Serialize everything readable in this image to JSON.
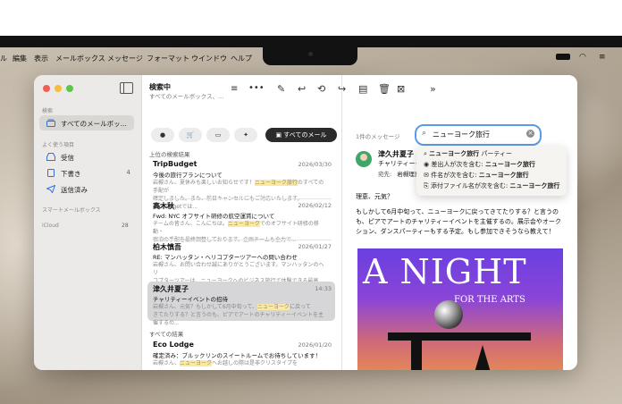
{
  "menubar": {
    "items": [
      "ル",
      "編集",
      "表示",
      "メールボックス",
      "メッセージ",
      "フォーマット",
      "ウインドウ",
      "ヘルプ"
    ]
  },
  "toolbar": {
    "title": "検索中",
    "subtitle": "すべてのメールボックス、..."
  },
  "sidebar": {
    "favorites_label": "検索",
    "all_mail": "すべてのメールボッ...",
    "frequent_label": "よく使う項目",
    "items": [
      {
        "label": "受信",
        "count": ""
      },
      {
        "label": "下書き",
        "count": "4"
      },
      {
        "label": "送信済み",
        "count": ""
      }
    ],
    "smart_label": "スマートメールボックス",
    "icloud_label": "iCloud",
    "icloud_count": "28"
  },
  "filters": {
    "all_mail_chip": "すべてのメール"
  },
  "list": {
    "top_hits_label": "上位の検索結果",
    "all_results_label": "すべての結果",
    "messages": [
      {
        "from": "TripBudget",
        "date": "2026/03/30",
        "subject": "今後の旅行プランについて",
        "preview_a": "岩槻さん、夏休みも楽しいお知らせです！",
        "preview_hl": "ニューヨーク旅行",
        "preview_b": "のすべての手配が",
        "preview_c": "確定しました。また、前日キャンセルにもご対応いたします。TripBudgetでは..."
      },
      {
        "from": "高木秋",
        "date": "2026/02/12",
        "subject": "Fwd: NYC オフサイト研修の航空運賃について",
        "preview_a": "チームの皆さん、こんにちは。",
        "preview_hl": "ニューヨーク",
        "preview_b": "でのオフサイト研修の移動・",
        "preview_c": "宿泊の手配を最終調整しております。企画チームも全力で..."
      },
      {
        "from": "柏木慎吾",
        "date": "2026/01/27",
        "subject": "RE: マンハッタン・ヘリコプターツアーへの問い合わせ",
        "preview_a": "岩槻さん、お問い合わせ誠にありがとうございます。マンハッタンのヘリ",
        "preview_hl": "ニューヨーク",
        "preview_b": "",
        "preview_c": "コプターツアーは、ニューヨークへのビジネス旅行で体験できる最高の..."
      },
      {
        "from": "津久井夏子",
        "date": "14:33",
        "subject": "チャリティーイベントの招待",
        "preview_a": "岩槻さん、元気？もしかして6月中旬って、",
        "preview_hl": "ニューヨーク",
        "preview_b": "に戻って",
        "preview_c": "きてたりする？と言うのも、ピアでアートのチャリティーイベントを主催するの..."
      },
      {
        "from": "Eco Lodge",
        "date": "2026/01/20",
        "subject": "確定済み：ブルックリンのスイートルームでお待ちしています！",
        "preview_a": "岩槻さん、",
        "preview_hl": "ニューヨーク",
        "preview_b": "へお越しの際は是非クリスタイプを",
        "preview_c": "ご利用..."
      }
    ]
  },
  "search": {
    "query": "ニューヨーク旅行",
    "suggestions": [
      {
        "prefix": "",
        "bold": "ニューヨーク旅行",
        "suffix": " パーティー"
      },
      {
        "prefix": "差出人が次を含む: ",
        "bold": "ニューヨーク旅行",
        "suffix": ""
      },
      {
        "prefix": "件名が次を含む: ",
        "bold": "ニューヨーク旅行",
        "suffix": ""
      },
      {
        "prefix": "添付ファイル名が次を含む: ",
        "bold": "ニューヨーク旅行",
        "suffix": ""
      }
    ]
  },
  "reader": {
    "count_label": "1件のメッセージ",
    "sender": "津久井夏子",
    "subject": "チャリティーイベントの招待",
    "to_label": "宛先:",
    "to_name": "岩槻理恵",
    "greeting": "理恵、元気？",
    "body": "もしかして6月中旬って、ニューヨークに戻ってきてたりする？と言うのも、ピアでアートのチャリティーイベントを主催するの。展示会やオークション、ダンスパーティーもする予定。もし参加できそうなら教えて！",
    "poster_title": "A NIGHT",
    "poster_sub": "FOR THE ARTS"
  },
  "colors": {
    "accent": "#2f6fe0",
    "highlight": "#fbe9a0",
    "selected_row": "#d6d6d8"
  }
}
